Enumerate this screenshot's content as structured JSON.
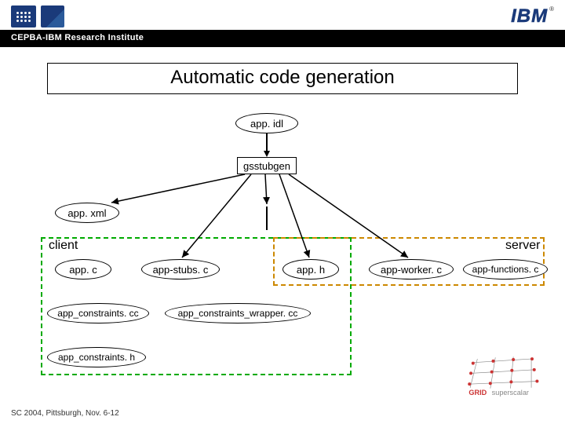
{
  "header": {
    "institute": "CEPBA-IBM Research Institute",
    "ibm": "IBM",
    "reg": "®"
  },
  "title": "Automatic code generation",
  "nodes": {
    "app_idl": "app. idl",
    "gsstubgen": "gsstubgen",
    "app_xml": "app. xml",
    "client": "client",
    "server": "server",
    "app_c": "app. c",
    "app_stubs_c": "app-stubs. c",
    "app_h": "app. h",
    "app_worker_c": "app-worker. c",
    "app_functions_c": "app-functions. c",
    "app_constraints_cc": "app_constraints. cc",
    "app_constraints_wrapper_cc": "app_constraints_wrapper. cc",
    "app_constraints_h": "app_constraints. h"
  },
  "footer": "SC 2004, Pittsburgh, Nov. 6-12",
  "grid_logo": "GRID superscalar"
}
